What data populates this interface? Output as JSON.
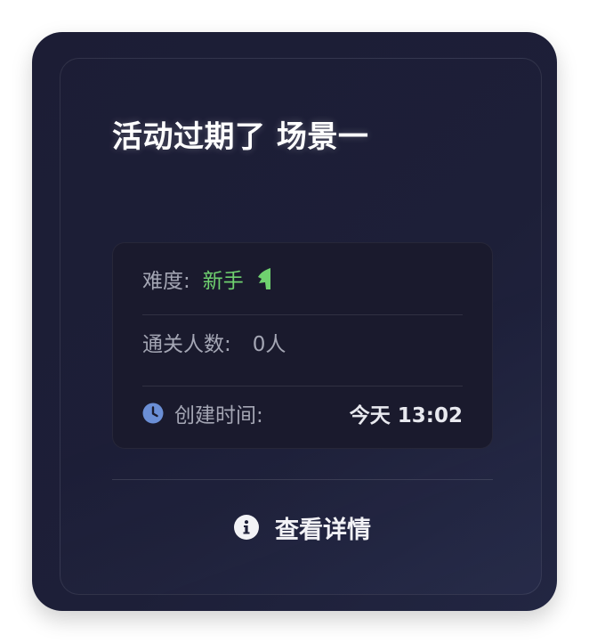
{
  "card": {
    "title": "活动过期了 场景一"
  },
  "info": {
    "difficulty_label": "难度:",
    "difficulty_value": "新手",
    "difficulty_icon": "leaf-icon",
    "clear_count_label": "通关人数:",
    "clear_count_value": "0人",
    "created_label": "创建时间:",
    "created_value": "今天 13:02",
    "created_icon": "clock-icon"
  },
  "footer": {
    "details_label": "查看详情",
    "details_icon": "info-icon"
  },
  "colors": {
    "card_background": "#1d1f38",
    "panel_background": "#1a1a2d",
    "difficulty_green": "#6fd16f",
    "clock_blue": "#6b8fd6",
    "text_gray": "#a4a6b4",
    "text_white": "#ffffff"
  }
}
